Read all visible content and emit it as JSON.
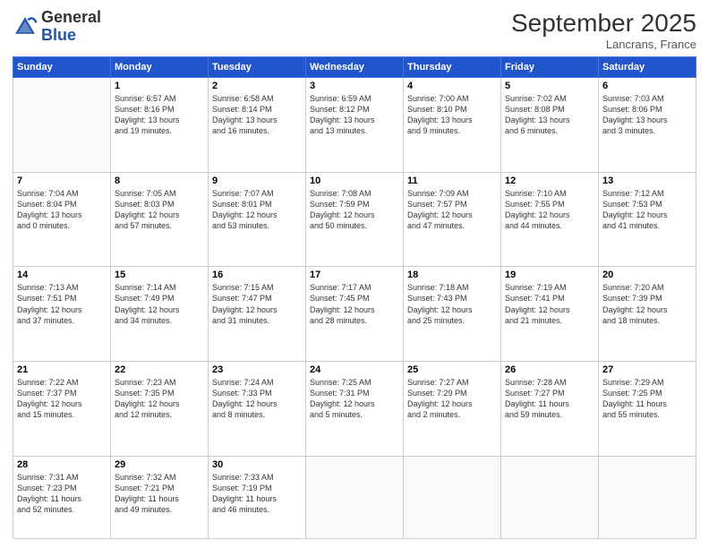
{
  "logo": {
    "general": "General",
    "blue": "Blue"
  },
  "header": {
    "month": "September 2025",
    "location": "Lancrans, France"
  },
  "days_of_week": [
    "Sunday",
    "Monday",
    "Tuesday",
    "Wednesday",
    "Thursday",
    "Friday",
    "Saturday"
  ],
  "weeks": [
    [
      {
        "day": "",
        "info": ""
      },
      {
        "day": "1",
        "info": "Sunrise: 6:57 AM\nSunset: 8:16 PM\nDaylight: 13 hours\nand 19 minutes."
      },
      {
        "day": "2",
        "info": "Sunrise: 6:58 AM\nSunset: 8:14 PM\nDaylight: 13 hours\nand 16 minutes."
      },
      {
        "day": "3",
        "info": "Sunrise: 6:59 AM\nSunset: 8:12 PM\nDaylight: 13 hours\nand 13 minutes."
      },
      {
        "day": "4",
        "info": "Sunrise: 7:00 AM\nSunset: 8:10 PM\nDaylight: 13 hours\nand 9 minutes."
      },
      {
        "day": "5",
        "info": "Sunrise: 7:02 AM\nSunset: 8:08 PM\nDaylight: 13 hours\nand 6 minutes."
      },
      {
        "day": "6",
        "info": "Sunrise: 7:03 AM\nSunset: 8:06 PM\nDaylight: 13 hours\nand 3 minutes."
      }
    ],
    [
      {
        "day": "7",
        "info": "Sunrise: 7:04 AM\nSunset: 8:04 PM\nDaylight: 13 hours\nand 0 minutes."
      },
      {
        "day": "8",
        "info": "Sunrise: 7:05 AM\nSunset: 8:03 PM\nDaylight: 12 hours\nand 57 minutes."
      },
      {
        "day": "9",
        "info": "Sunrise: 7:07 AM\nSunset: 8:01 PM\nDaylight: 12 hours\nand 53 minutes."
      },
      {
        "day": "10",
        "info": "Sunrise: 7:08 AM\nSunset: 7:59 PM\nDaylight: 12 hours\nand 50 minutes."
      },
      {
        "day": "11",
        "info": "Sunrise: 7:09 AM\nSunset: 7:57 PM\nDaylight: 12 hours\nand 47 minutes."
      },
      {
        "day": "12",
        "info": "Sunrise: 7:10 AM\nSunset: 7:55 PM\nDaylight: 12 hours\nand 44 minutes."
      },
      {
        "day": "13",
        "info": "Sunrise: 7:12 AM\nSunset: 7:53 PM\nDaylight: 12 hours\nand 41 minutes."
      }
    ],
    [
      {
        "day": "14",
        "info": "Sunrise: 7:13 AM\nSunset: 7:51 PM\nDaylight: 12 hours\nand 37 minutes."
      },
      {
        "day": "15",
        "info": "Sunrise: 7:14 AM\nSunset: 7:49 PM\nDaylight: 12 hours\nand 34 minutes."
      },
      {
        "day": "16",
        "info": "Sunrise: 7:15 AM\nSunset: 7:47 PM\nDaylight: 12 hours\nand 31 minutes."
      },
      {
        "day": "17",
        "info": "Sunrise: 7:17 AM\nSunset: 7:45 PM\nDaylight: 12 hours\nand 28 minutes."
      },
      {
        "day": "18",
        "info": "Sunrise: 7:18 AM\nSunset: 7:43 PM\nDaylight: 12 hours\nand 25 minutes."
      },
      {
        "day": "19",
        "info": "Sunrise: 7:19 AM\nSunset: 7:41 PM\nDaylight: 12 hours\nand 21 minutes."
      },
      {
        "day": "20",
        "info": "Sunrise: 7:20 AM\nSunset: 7:39 PM\nDaylight: 12 hours\nand 18 minutes."
      }
    ],
    [
      {
        "day": "21",
        "info": "Sunrise: 7:22 AM\nSunset: 7:37 PM\nDaylight: 12 hours\nand 15 minutes."
      },
      {
        "day": "22",
        "info": "Sunrise: 7:23 AM\nSunset: 7:35 PM\nDaylight: 12 hours\nand 12 minutes."
      },
      {
        "day": "23",
        "info": "Sunrise: 7:24 AM\nSunset: 7:33 PM\nDaylight: 12 hours\nand 8 minutes."
      },
      {
        "day": "24",
        "info": "Sunrise: 7:25 AM\nSunset: 7:31 PM\nDaylight: 12 hours\nand 5 minutes."
      },
      {
        "day": "25",
        "info": "Sunrise: 7:27 AM\nSunset: 7:29 PM\nDaylight: 12 hours\nand 2 minutes."
      },
      {
        "day": "26",
        "info": "Sunrise: 7:28 AM\nSunset: 7:27 PM\nDaylight: 11 hours\nand 59 minutes."
      },
      {
        "day": "27",
        "info": "Sunrise: 7:29 AM\nSunset: 7:25 PM\nDaylight: 11 hours\nand 55 minutes."
      }
    ],
    [
      {
        "day": "28",
        "info": "Sunrise: 7:31 AM\nSunset: 7:23 PM\nDaylight: 11 hours\nand 52 minutes."
      },
      {
        "day": "29",
        "info": "Sunrise: 7:32 AM\nSunset: 7:21 PM\nDaylight: 11 hours\nand 49 minutes."
      },
      {
        "day": "30",
        "info": "Sunrise: 7:33 AM\nSunset: 7:19 PM\nDaylight: 11 hours\nand 46 minutes."
      },
      {
        "day": "",
        "info": ""
      },
      {
        "day": "",
        "info": ""
      },
      {
        "day": "",
        "info": ""
      },
      {
        "day": "",
        "info": ""
      }
    ]
  ]
}
